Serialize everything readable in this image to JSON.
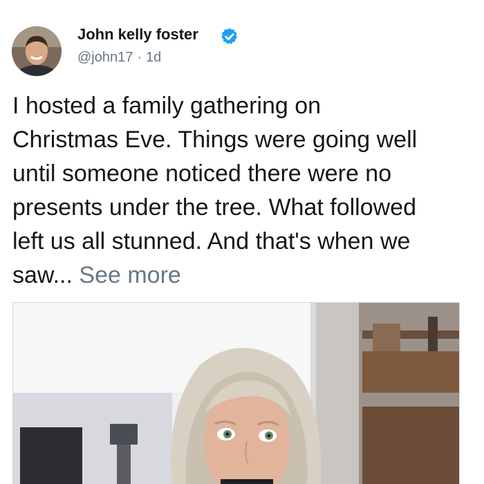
{
  "post": {
    "author": {
      "name": "John kelly foster",
      "handle": "@john17",
      "separator": "·",
      "time": "1d",
      "verified_icon": "verified-badge-icon",
      "avatar_icon": "user-avatar-photo"
    },
    "text_lines": [
      "I hosted a family gathering on",
      "Christmas Eve. Things were going well",
      "until someone noticed there were no",
      "presents under the tree. What followed",
      "left us all stunned. And that's when we",
      "saw..."
    ],
    "see_more": "See more",
    "media": {
      "subject": "older-woman-surprised-photo"
    },
    "colors": {
      "verified": "#1da1f2",
      "secondary_text": "#657786",
      "primary_text": "#14171a"
    }
  }
}
